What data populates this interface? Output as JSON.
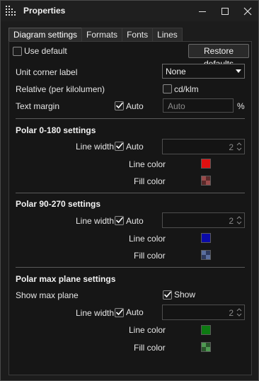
{
  "window": {
    "title": "Properties",
    "controls": {
      "minimize": "minimize-icon",
      "maximize": "maximize-icon",
      "close": "close-icon"
    }
  },
  "tabs": [
    {
      "label": "Diagram settings",
      "active": true
    },
    {
      "label": "Formats",
      "active": false
    },
    {
      "label": "Fonts",
      "active": false
    },
    {
      "label": "Lines",
      "active": false
    }
  ],
  "general": {
    "use_default_label": "Use default",
    "use_default_checked": false,
    "restore_label": "Restore defaults",
    "unit_corner_label": "Unit corner label",
    "unit_corner_value": "None",
    "relative_label": "Relative (per kilolumen)",
    "relative_option_label": "cd/klm",
    "relative_checked": false,
    "text_margin_label": "Text margin",
    "text_margin_auto_label": "Auto",
    "text_margin_auto_checked": true,
    "text_margin_placeholder": "Auto",
    "text_margin_unit": "%"
  },
  "polar_0_180": {
    "heading": "Polar 0-180 settings",
    "line_width_label": "Line width",
    "auto_label": "Auto",
    "auto_checked": true,
    "line_width_value": "2",
    "line_color_label": "Line color",
    "line_color": "#e01010",
    "fill_color_label": "Fill color",
    "fill_color": "#8a3a3a"
  },
  "polar_90_270": {
    "heading": "Polar 90-270 settings",
    "line_width_label": "Line width",
    "auto_label": "Auto",
    "auto_checked": true,
    "line_width_value": "2",
    "line_color_label": "Line color",
    "line_color": "#0b0ba8",
    "fill_color_label": "Fill color",
    "fill_color": "#4a5a8a"
  },
  "polar_max": {
    "heading": "Polar max plane settings",
    "show_max_plane_label": "Show max plane",
    "show_label": "Show",
    "show_checked": true,
    "line_width_label": "Line width",
    "auto_label": "Auto",
    "auto_checked": true,
    "line_width_value": "2",
    "line_color_label": "Line color",
    "line_color": "#0d7a12",
    "fill_color_label": "Fill color",
    "fill_color": "#3f7f42"
  }
}
